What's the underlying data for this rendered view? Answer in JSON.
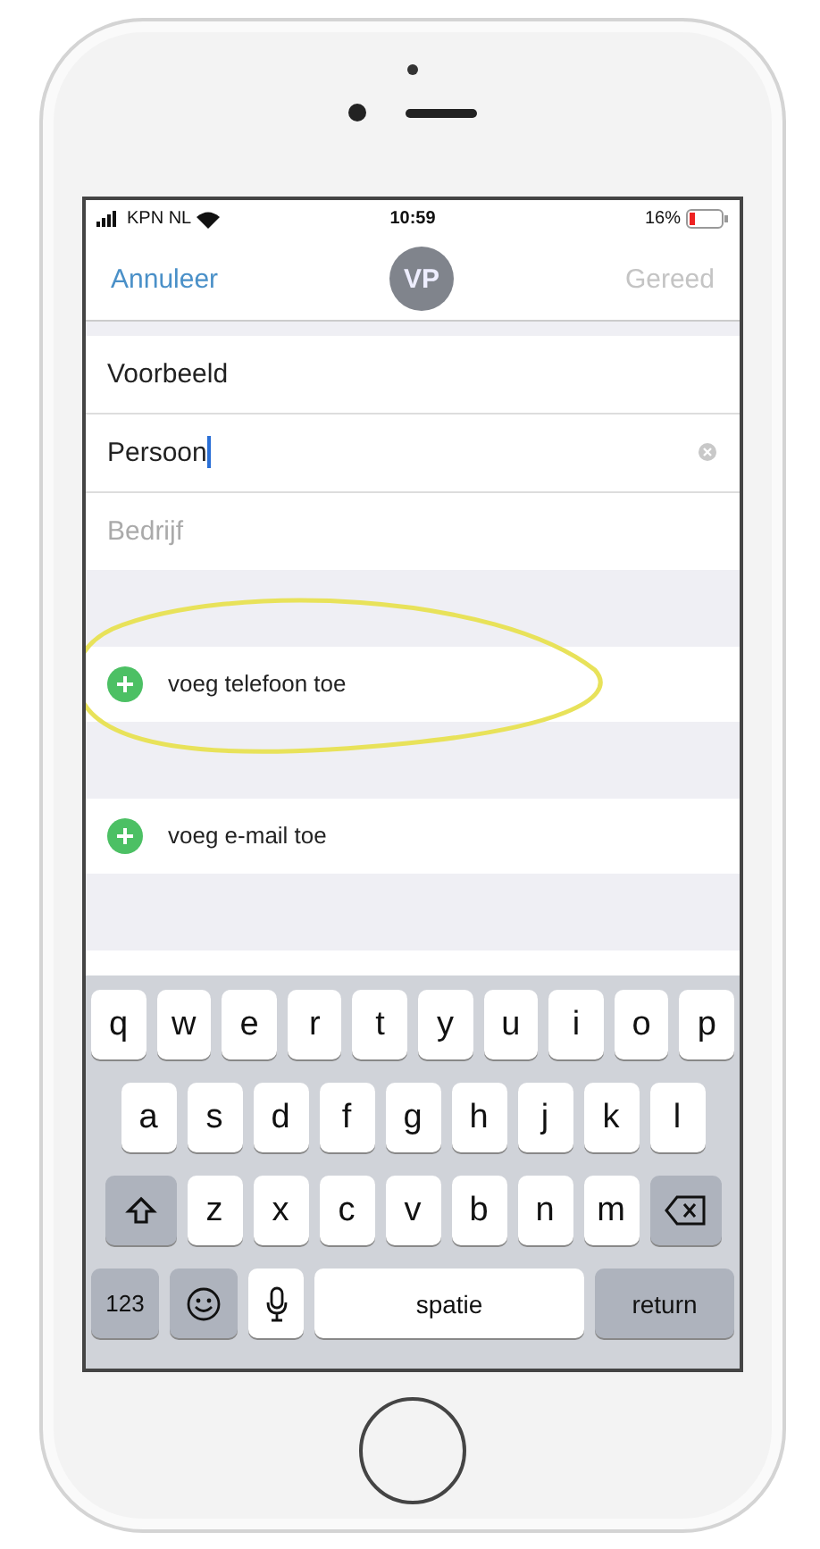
{
  "status_bar": {
    "carrier": "KPN NL",
    "time": "10:59",
    "battery": "16%"
  },
  "nav": {
    "cancel": "Annuleer",
    "avatar_initials": "VP",
    "done": "Gereed",
    "done_disabled": true
  },
  "name_fields": [
    {
      "value": "Voorbeeld",
      "focused": false
    },
    {
      "value": "Persoon",
      "focused": true
    },
    {
      "placeholder": "Bedrijf",
      "focused": false
    }
  ],
  "add_rows": [
    {
      "label": "voeg telefoon toe",
      "highlighted": true
    },
    {
      "label": "voeg e-mail toe",
      "highlighted": false
    }
  ],
  "keyboard": {
    "top_row": [
      {
        "kind": "letter",
        "label": "q"
      },
      {
        "kind": "letter",
        "label": "w"
      },
      {
        "kind": "letter",
        "label": "e"
      },
      {
        "kind": "letter",
        "label": "r"
      },
      {
        "kind": "letter",
        "label": "t"
      },
      {
        "kind": "letter",
        "label": "y"
      },
      {
        "kind": "letter",
        "label": "u"
      },
      {
        "kind": "letter",
        "label": "i"
      },
      {
        "kind": "letter",
        "label": "o"
      },
      {
        "kind": "letter",
        "label": "p"
      }
    ],
    "middle_row": [
      {
        "kind": "letter",
        "label": "a"
      },
      {
        "kind": "letter",
        "label": "s"
      },
      {
        "kind": "letter",
        "label": "d"
      },
      {
        "kind": "letter",
        "label": "f"
      },
      {
        "kind": "letter",
        "label": "g"
      },
      {
        "kind": "letter",
        "label": "h"
      },
      {
        "kind": "letter",
        "label": "j"
      },
      {
        "kind": "letter",
        "label": "k"
      },
      {
        "kind": "letter",
        "label": "l"
      }
    ],
    "lower_row": [
      {
        "kind": "shift"
      },
      {
        "kind": "letter",
        "label": "z"
      },
      {
        "kind": "letter",
        "label": "x"
      },
      {
        "kind": "letter",
        "label": "c"
      },
      {
        "kind": "letter",
        "label": "v"
      },
      {
        "kind": "letter",
        "label": "b"
      },
      {
        "kind": "letter",
        "label": "n"
      },
      {
        "kind": "letter",
        "label": "m"
      },
      {
        "kind": "delete"
      }
    ],
    "bottom_row": [
      {
        "kind": "numbers",
        "label": "123"
      },
      {
        "kind": "emoji"
      },
      {
        "kind": "mic"
      },
      {
        "kind": "space",
        "label": "spatie"
      },
      {
        "kind": "return",
        "label": "return"
      }
    ]
  }
}
